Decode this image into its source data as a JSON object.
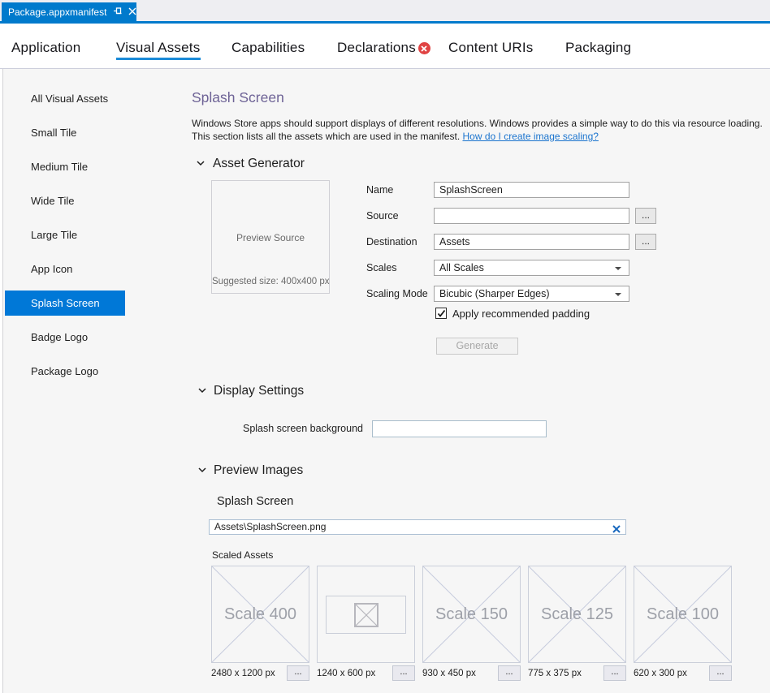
{
  "editor_tab": {
    "title": "Package.appxmanifest"
  },
  "nav": {
    "tabs": [
      {
        "label": "Application"
      },
      {
        "label": "Visual Assets",
        "selected": true
      },
      {
        "label": "Capabilities"
      },
      {
        "label": "Declarations",
        "error": true
      },
      {
        "label": "Content URIs"
      },
      {
        "label": "Packaging"
      }
    ]
  },
  "sidebar": {
    "items": [
      {
        "label": "All Visual Assets"
      },
      {
        "label": "Small Tile"
      },
      {
        "label": "Medium Tile"
      },
      {
        "label": "Wide Tile"
      },
      {
        "label": "Large Tile"
      },
      {
        "label": "App Icon"
      },
      {
        "label": "Splash Screen",
        "selected": true
      },
      {
        "label": "Badge Logo"
      },
      {
        "label": "Package Logo"
      }
    ]
  },
  "main": {
    "title": "Splash Screen",
    "description_line1": "Windows Store apps should support displays of different resolutions. Windows provides a simple way to do this via resource loading.",
    "description_line2": "This section lists all the assets which are used in the manifest.",
    "description_link": "How do I create image scaling?",
    "asset_generator": {
      "label": "Asset Generator",
      "preview_source": "Preview Source",
      "suggested_size": "Suggested size: 400x400 px",
      "fields": [
        {
          "label": "Name",
          "value": "SplashScreen"
        },
        {
          "label": "Source",
          "value": ""
        },
        {
          "label": "Destination",
          "value": "Assets"
        },
        {
          "label": "Scales",
          "value": "All Scales"
        },
        {
          "label": "Scaling Mode",
          "value": "Bicubic (Sharper Edges)"
        }
      ],
      "browse_label": "...",
      "checkbox_label": "Apply recommended padding",
      "checkbox_checked": true,
      "generate_label": "Generate"
    },
    "display_settings": {
      "label": "Display Settings",
      "field_label": "Splash screen background",
      "field_value": ""
    },
    "preview_images": {
      "label": "Preview Images",
      "subsection_label": "Splash Screen",
      "path_value": "Assets\\SplashScreen.png",
      "scaled_assets_label": "Scaled Assets",
      "browse_label": "...",
      "assets": [
        {
          "placeholder": "Scale 400",
          "size": "2480 x 1200 px",
          "has_image": false
        },
        {
          "placeholder": "",
          "size": "1240 x 600 px",
          "has_image": true
        },
        {
          "placeholder": "Scale 150",
          "size": "930 x 450 px",
          "has_image": false
        },
        {
          "placeholder": "Scale 125",
          "size": "775 x 375 px",
          "has_image": false
        },
        {
          "placeholder": "Scale 100",
          "size": "620 x 300 px",
          "has_image": false
        }
      ]
    }
  },
  "colors": {
    "tab_blue": "#007ACC",
    "selection_blue": "#0078D7",
    "error_red": "#E04343",
    "title_purple": "#6E6396",
    "link_blue": "#1B74CE"
  }
}
